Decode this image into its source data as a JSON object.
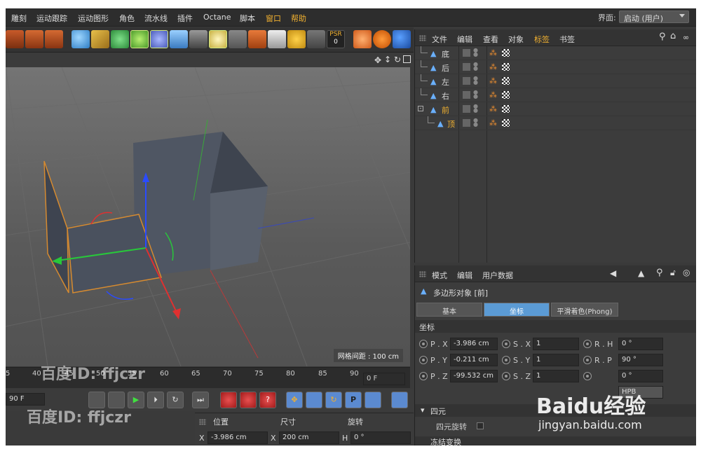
{
  "menubar": {
    "items": [
      "雕刻",
      "运动跟踪",
      "运动图形",
      "角色",
      "流水线",
      "插件",
      "Octane",
      "脚本",
      "窗口",
      "帮助"
    ],
    "layout_label": "界面:",
    "layout_value": "启动 (用户)"
  },
  "toolbar": {
    "psr_label": "PSR",
    "psr_value": "0"
  },
  "viewport": {
    "grid_spacing": "网格间距 : 100 cm"
  },
  "object_manager": {
    "menu": [
      "文件",
      "编辑",
      "查看",
      "对象",
      "标签",
      "书签"
    ],
    "objects": [
      {
        "name": "底",
        "active": false
      },
      {
        "name": "后",
        "active": false
      },
      {
        "name": "左",
        "active": false
      },
      {
        "name": "右",
        "active": false
      },
      {
        "name": "前",
        "active": true
      },
      {
        "name": "顶",
        "active": true
      }
    ]
  },
  "attribute_manager": {
    "menu": [
      "模式",
      "编辑",
      "用户数据"
    ],
    "object_title": "多边形对象 [前]",
    "tabs": [
      "基本",
      "坐标",
      "平滑着色(Phong)"
    ],
    "active_tab": "坐标",
    "section": "坐标",
    "fields": {
      "px_label": "P . X",
      "px": "-3.986 cm",
      "py_label": "P . Y",
      "py": "-0.211 cm",
      "pz_label": "P . Z",
      "pz": "-99.532 cm",
      "sx_label": "S . X",
      "sx": "1",
      "sy_label": "S . Y",
      "sy": "1",
      "sz_label": "S . Z",
      "sz": "1",
      "rh_label": "R . H",
      "rh": "0 °",
      "rp_label": "R . P",
      "rp": "90 °",
      "rb": "0 °",
      "order": "HPB"
    },
    "quat_section": "四元",
    "quat_rotation": "四元旋转",
    "next_section": "冻结变换"
  },
  "timeline": {
    "ticks": [
      "5",
      "40",
      "45",
      "50",
      "55",
      "60",
      "65",
      "70",
      "75",
      "80",
      "85",
      "90"
    ],
    "current_frame": "0 F",
    "end_frame": "90 F"
  },
  "coord_panel": {
    "headers": [
      "位置",
      "尺寸",
      "旋转"
    ],
    "x_label": "X",
    "x_pos": "-3.986 cm",
    "size_label": "X",
    "x_size": "200 cm",
    "rot_label": "H",
    "h_rot": "0 °"
  },
  "watermark": {
    "baidu_id": "百度ID: ffjczr",
    "baidu_logo": "Baidu经验",
    "baidu_url": "jingyan.baidu.com"
  }
}
